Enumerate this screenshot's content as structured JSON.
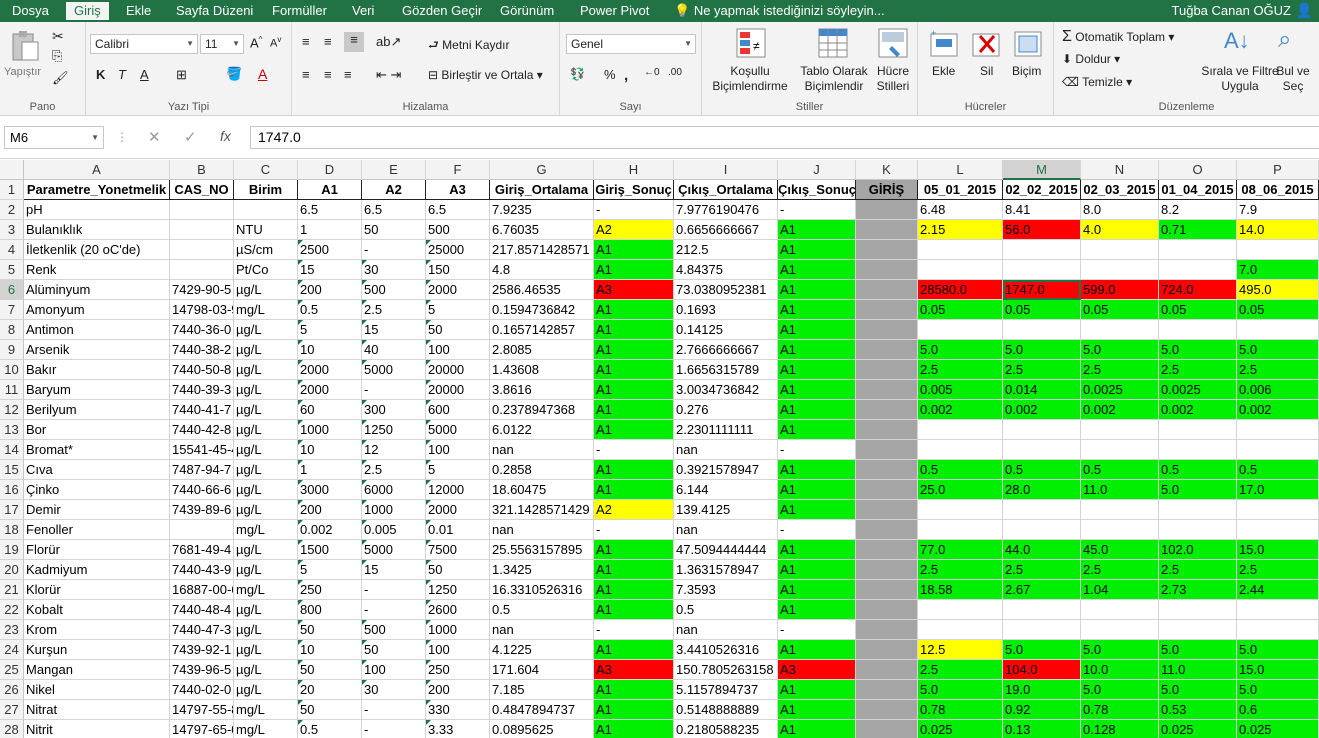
{
  "ribbon_tabs": [
    "Dosya",
    "Giriş",
    "Ekle",
    "Sayfa Düzeni",
    "Formüller",
    "Veri",
    "Gözden Geçir",
    "Görünüm",
    "Power Pivot"
  ],
  "tell_me": "Ne yapmak istediğinizi söyleyin...",
  "user_name": "Tuğba Canan OĞUZ",
  "groups": {
    "clipboard": {
      "label": "Pano",
      "paste": "Yapıştır"
    },
    "font": {
      "label": "Yazı Tipi",
      "name": "Calibri",
      "size": "11",
      "bold": "K",
      "italic": "T",
      "underline": "A"
    },
    "alignment": {
      "label": "Hizalama",
      "wrap": "Metni Kaydır",
      "merge": "Birleştir ve Ortala"
    },
    "number": {
      "label": "Sayı",
      "format": "Genel"
    },
    "styles": {
      "label": "Stiller",
      "cond_l1": "Koşullu",
      "cond_l2": "Biçimlendirme",
      "table_l1": "Tablo Olarak",
      "table_l2": "Biçimlendir",
      "cell_l1": "Hücre",
      "cell_l2": "Stilleri"
    },
    "cells": {
      "label": "Hücreler",
      "insert": "Ekle",
      "delete": "Sil",
      "format": "Biçim"
    },
    "editing": {
      "label": "Düzenleme",
      "autosum": "Otomatik Toplam",
      "fill": "Doldur",
      "clear": "Temizle",
      "sort_l1": "Sırala ve Filtre",
      "sort_l2": "Uygula",
      "find_l1": "Bul ve",
      "find_l2": "Seç"
    }
  },
  "name_box": "M6",
  "formula_value": "1747.0",
  "columns": [
    "A",
    "B",
    "C",
    "D",
    "E",
    "F",
    "G",
    "H",
    "I",
    "J",
    "K",
    "L",
    "M",
    "N",
    "O",
    "P"
  ],
  "selected_column": "M",
  "selected_row": "6",
  "headers": [
    "Parametre_Yonetmelik",
    "CAS_NO",
    "Birim",
    "A1",
    "A2",
    "A3",
    "Giriş_Ortalama",
    "Giriş_Sonuç",
    "Çıkış_Ortalama",
    "Çıkış_Sonuç",
    "GİRİŞ",
    "05_01_2015",
    "02_02_2015",
    "02_03_2015",
    "01_04_2015",
    "08_06_2015"
  ],
  "rows": [
    [
      "pH",
      "",
      "",
      "6.5",
      "6.5",
      "6.5",
      "7.9235",
      "-",
      "7.9776190476",
      "-",
      "",
      "6.48",
      "8.41",
      "8.0",
      "8.2",
      "7.9"
    ],
    [
      "Bulanıklık",
      "",
      "NTU",
      "1",
      "50",
      "500",
      "6.76035",
      "A2",
      "0.6656666667",
      "A1",
      "",
      "2.15",
      "56.0",
      "4.0",
      "0.71",
      "14.0"
    ],
    [
      "İletkenlik (20 oC'de)",
      "",
      "µS/cm",
      "2500",
      "-",
      "25000",
      "217.8571428571",
      "A1",
      "212.5",
      "A1",
      "",
      "",
      "",
      "",
      "",
      ""
    ],
    [
      "Renk",
      "",
      "Pt/Co",
      "15",
      "30",
      "150",
      "4.8",
      "A1",
      "4.84375",
      "A1",
      "",
      "",
      "",
      "",
      "",
      "7.0"
    ],
    [
      "Alüminyum",
      "7429-90-5",
      "µg/L",
      "200",
      "500",
      "2000",
      "2586.46535",
      "A3",
      "73.0380952381",
      "A1",
      "",
      "28580.0",
      "1747.0",
      "599.0",
      "724.0",
      "495.0"
    ],
    [
      "Amonyum",
      "14798-03-9",
      "mg/L",
      "0.5",
      "2.5",
      "5",
      "0.1594736842",
      "A1",
      "0.1693",
      "A1",
      "",
      "0.05",
      "0.05",
      "0.05",
      "0.05",
      "0.05"
    ],
    [
      "Antimon",
      "7440-36-0",
      "µg/L",
      "5",
      "15",
      "50",
      "0.1657142857",
      "A1",
      "0.14125",
      "A1",
      "",
      "",
      "",
      "",
      "",
      ""
    ],
    [
      "Arsenik",
      "7440-38-2",
      "µg/L",
      "10",
      "40",
      "100",
      "2.8085",
      "A1",
      "2.7666666667",
      "A1",
      "",
      "5.0",
      "5.0",
      "5.0",
      "5.0",
      "5.0"
    ],
    [
      "Bakır",
      "7440-50-8",
      "µg/L",
      "2000",
      "5000",
      "20000",
      "1.43608",
      "A1",
      "1.6656315789",
      "A1",
      "",
      "2.5",
      "2.5",
      "2.5",
      "2.5",
      "2.5"
    ],
    [
      "Baryum",
      "7440-39-3",
      "µg/L",
      "2000",
      "-",
      "20000",
      "3.8616",
      "A1",
      "3.0034736842",
      "A1",
      "",
      "0.005",
      "0.014",
      "0.0025",
      "0.0025",
      "0.006"
    ],
    [
      "Berilyum",
      "7440-41-7",
      "µg/L",
      "60",
      "300",
      "600",
      "0.2378947368",
      "A1",
      "0.276",
      "A1",
      "",
      "0.002",
      "0.002",
      "0.002",
      "0.002",
      "0.002"
    ],
    [
      "Bor",
      "7440-42-8",
      "µg/L",
      "1000",
      "1250",
      "5000",
      "6.0122",
      "A1",
      "2.2301111111",
      "A1",
      "",
      "",
      "",
      "",
      "",
      ""
    ],
    [
      "Bromat*",
      "15541-45-4",
      "µg/L",
      "10",
      "12",
      "100",
      "nan",
      "-",
      "nan",
      "-",
      "",
      "",
      "",
      "",
      "",
      ""
    ],
    [
      "Cıva",
      "7487-94-7",
      "µg/L",
      "1",
      "2.5",
      "5",
      "0.2858",
      "A1",
      "0.3921578947",
      "A1",
      "",
      "0.5",
      "0.5",
      "0.5",
      "0.5",
      "0.5"
    ],
    [
      "Çinko",
      "7440-66-6",
      "µg/L",
      "3000",
      "6000",
      "12000",
      "18.60475",
      "A1",
      "6.144",
      "A1",
      "",
      "25.0",
      "28.0",
      "11.0",
      "5.0",
      "17.0"
    ],
    [
      "Demir",
      "7439-89-6",
      "µg/L",
      "200",
      "1000",
      "2000",
      "321.1428571429",
      "A2",
      "139.4125",
      "A1",
      "",
      "",
      "",
      "",
      "",
      ""
    ],
    [
      "Fenoller",
      "",
      "mg/L",
      "0.002",
      "0.005",
      "0.01",
      "nan",
      "-",
      "nan",
      "-",
      "",
      "",
      "",
      "",
      "",
      ""
    ],
    [
      "Florür",
      "7681-49-4",
      "µg/L",
      "1500",
      "5000",
      "7500",
      "25.5563157895",
      "A1",
      "47.5094444444",
      "A1",
      "",
      "77.0",
      "44.0",
      "45.0",
      "102.0",
      "15.0"
    ],
    [
      "Kadmiyum",
      "7440-43-9",
      "µg/L",
      "5",
      "15",
      "50",
      "1.3425",
      "A1",
      "1.3631578947",
      "A1",
      "",
      "2.5",
      "2.5",
      "2.5",
      "2.5",
      "2.5"
    ],
    [
      "Klorür",
      "16887-00-6",
      "mg/L",
      "250",
      "-",
      "1250",
      "16.3310526316",
      "A1",
      "7.3593",
      "A1",
      "",
      "18.58",
      "2.67",
      "1.04",
      "2.73",
      "2.44"
    ],
    [
      "Kobalt",
      "7440-48-4",
      "µg/L",
      "800",
      "-",
      "2600",
      "0.5",
      "A1",
      "0.5",
      "A1",
      "",
      "",
      "",
      "",
      "",
      ""
    ],
    [
      "Krom",
      "7440-47-3",
      "µg/L",
      "50",
      "500",
      "1000",
      "nan",
      "-",
      "nan",
      "-",
      "",
      "",
      "",
      "",
      "",
      ""
    ],
    [
      "Kurşun",
      "7439-92-1",
      "µg/L",
      "10",
      "50",
      "100",
      "4.1225",
      "A1",
      "3.4410526316",
      "A1",
      "",
      "12.5",
      "5.0",
      "5.0",
      "5.0",
      "5.0"
    ],
    [
      "Mangan",
      "7439-96-5",
      "µg/L",
      "50",
      "100",
      "250",
      "171.604",
      "A3",
      "150.7805263158",
      "A3",
      "",
      "2.5",
      "104.0",
      "10.0",
      "11.0",
      "15.0"
    ],
    [
      "Nikel",
      "7440-02-0",
      "µg/L",
      "20",
      "30",
      "200",
      "7.185",
      "A1",
      "5.1157894737",
      "A1",
      "",
      "5.0",
      "19.0",
      "5.0",
      "5.0",
      "5.0"
    ],
    [
      "Nitrat",
      "14797-55-8",
      "mg/L",
      "50",
      "-",
      "330",
      "0.4847894737",
      "A1",
      "0.5148888889",
      "A1",
      "",
      "0.78",
      "0.92",
      "0.78",
      "0.53",
      "0.6"
    ],
    [
      "Nitrit",
      "14797-65-0",
      "mg/L",
      "0.5",
      "-",
      "3.33",
      "0.0895625",
      "A1",
      "0.2180588235",
      "A1",
      "",
      "0.025",
      "0.13",
      "0.128",
      "0.025",
      "0.025"
    ]
  ],
  "fills": [
    [
      "",
      "",
      "",
      "",
      "",
      "",
      "",
      "",
      "",
      "",
      "gray",
      "",
      "",
      "",
      "",
      ""
    ],
    [
      "",
      "",
      "",
      "",
      "",
      "",
      "",
      "y",
      "",
      "g",
      "gray",
      "y",
      "r",
      "y",
      "g",
      "y"
    ],
    [
      "",
      "",
      "",
      "",
      "",
      "",
      "",
      "g",
      "",
      "g",
      "gray",
      "",
      "",
      "",
      "",
      ""
    ],
    [
      "",
      "",
      "",
      "",
      "",
      "",
      "",
      "g",
      "",
      "g",
      "gray",
      "",
      "",
      "",
      "",
      "g"
    ],
    [
      "",
      "",
      "",
      "",
      "",
      "",
      "",
      "r",
      "",
      "g",
      "gray",
      "r",
      "r",
      "r",
      "r",
      "y"
    ],
    [
      "",
      "",
      "",
      "",
      "",
      "",
      "",
      "g",
      "",
      "g",
      "gray",
      "g",
      "g",
      "g",
      "g",
      "g"
    ],
    [
      "",
      "",
      "",
      "",
      "",
      "",
      "",
      "g",
      "",
      "g",
      "gray",
      "",
      "",
      "",
      "",
      ""
    ],
    [
      "",
      "",
      "",
      "",
      "",
      "",
      "",
      "g",
      "",
      "g",
      "gray",
      "g",
      "g",
      "g",
      "g",
      "g"
    ],
    [
      "",
      "",
      "",
      "",
      "",
      "",
      "",
      "g",
      "",
      "g",
      "gray",
      "g",
      "g",
      "g",
      "g",
      "g"
    ],
    [
      "",
      "",
      "",
      "",
      "",
      "",
      "",
      "g",
      "",
      "g",
      "gray",
      "g",
      "g",
      "g",
      "g",
      "g"
    ],
    [
      "",
      "",
      "",
      "",
      "",
      "",
      "",
      "g",
      "",
      "g",
      "gray",
      "g",
      "g",
      "g",
      "g",
      "g"
    ],
    [
      "",
      "",
      "",
      "",
      "",
      "",
      "",
      "g",
      "",
      "g",
      "gray",
      "",
      "",
      "",
      "",
      ""
    ],
    [
      "",
      "",
      "",
      "",
      "",
      "",
      "",
      "",
      "",
      "",
      "gray",
      "",
      "",
      "",
      "",
      ""
    ],
    [
      "",
      "",
      "",
      "",
      "",
      "",
      "",
      "g",
      "",
      "g",
      "gray",
      "g",
      "g",
      "g",
      "g",
      "g"
    ],
    [
      "",
      "",
      "",
      "",
      "",
      "",
      "",
      "g",
      "",
      "g",
      "gray",
      "g",
      "g",
      "g",
      "g",
      "g"
    ],
    [
      "",
      "",
      "",
      "",
      "",
      "",
      "",
      "y",
      "",
      "g",
      "gray",
      "",
      "",
      "",
      "",
      ""
    ],
    [
      "",
      "",
      "",
      "",
      "",
      "",
      "",
      "",
      "",
      "",
      "gray",
      "",
      "",
      "",
      "",
      ""
    ],
    [
      "",
      "",
      "",
      "",
      "",
      "",
      "",
      "g",
      "",
      "g",
      "gray",
      "g",
      "g",
      "g",
      "g",
      "g"
    ],
    [
      "",
      "",
      "",
      "",
      "",
      "",
      "",
      "g",
      "",
      "g",
      "gray",
      "g",
      "g",
      "g",
      "g",
      "g"
    ],
    [
      "",
      "",
      "",
      "",
      "",
      "",
      "",
      "g",
      "",
      "g",
      "gray",
      "g",
      "g",
      "g",
      "g",
      "g"
    ],
    [
      "",
      "",
      "",
      "",
      "",
      "",
      "",
      "g",
      "",
      "g",
      "gray",
      "",
      "",
      "",
      "",
      ""
    ],
    [
      "",
      "",
      "",
      "",
      "",
      "",
      "",
      "",
      "",
      "",
      "gray",
      "",
      "",
      "",
      "",
      ""
    ],
    [
      "",
      "",
      "",
      "",
      "",
      "",
      "",
      "g",
      "",
      "g",
      "gray",
      "y",
      "g",
      "g",
      "g",
      "g"
    ],
    [
      "",
      "",
      "",
      "",
      "",
      "",
      "",
      "r",
      "",
      "r",
      "gray",
      "g",
      "r",
      "g",
      "g",
      "g"
    ],
    [
      "",
      "",
      "",
      "",
      "",
      "",
      "",
      "g",
      "",
      "g",
      "gray",
      "g",
      "g",
      "g",
      "g",
      "g"
    ],
    [
      "",
      "",
      "",
      "",
      "",
      "",
      "",
      "g",
      "",
      "g",
      "gray",
      "g",
      "g",
      "g",
      "g",
      "g"
    ],
    [
      "",
      "",
      "",
      "",
      "",
      "",
      "",
      "g",
      "",
      "g",
      "gray",
      "g",
      "g",
      "g",
      "g",
      "g"
    ]
  ],
  "colors": {
    "excel_green": "#217346",
    "fill_green": "#00ee00",
    "fill_yellow": "#ffff00",
    "fill_red": "#ff0000",
    "separator_gray": "#a5a5a5"
  }
}
